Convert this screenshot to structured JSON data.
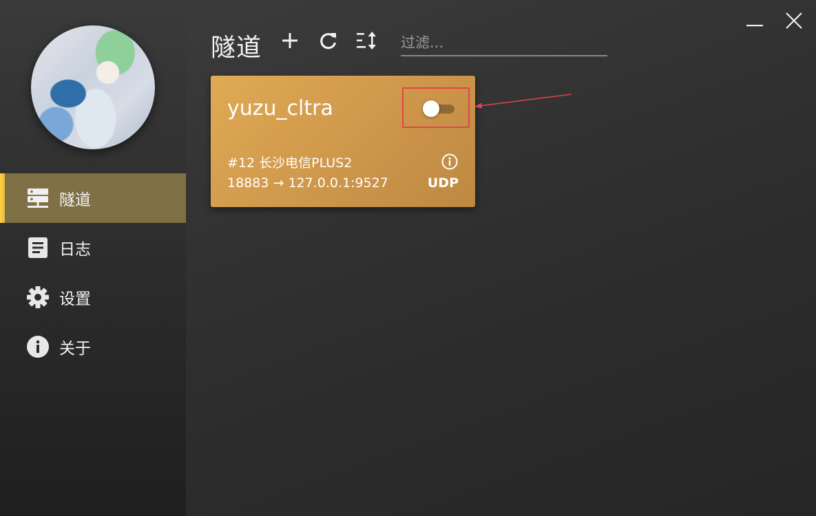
{
  "sidebar": {
    "items": [
      {
        "label": "隧道",
        "icon": "server-icon",
        "active": true
      },
      {
        "label": "日志",
        "icon": "log-icon",
        "active": false
      },
      {
        "label": "设置",
        "icon": "gear-icon",
        "active": false
      },
      {
        "label": "关于",
        "icon": "info-icon",
        "active": false
      }
    ]
  },
  "header": {
    "title": "隧道",
    "tools": [
      "add-icon",
      "refresh-icon",
      "sort-icon"
    ],
    "filter_placeholder": "过滤..."
  },
  "window_controls": [
    "minimize-icon",
    "close-icon"
  ],
  "tunnel_card": {
    "name": "yuzu_cltra",
    "enabled": false,
    "node": "#12 长沙电信PLUS2",
    "mapping": "18883 → 127.0.0.1:9527",
    "protocol": "UDP",
    "info_icon": "info-icon"
  },
  "colors": {
    "accent": "#ffd34a",
    "active_nav": "#7f7145",
    "card": "#d29a4c",
    "highlight": "#e0454d"
  }
}
